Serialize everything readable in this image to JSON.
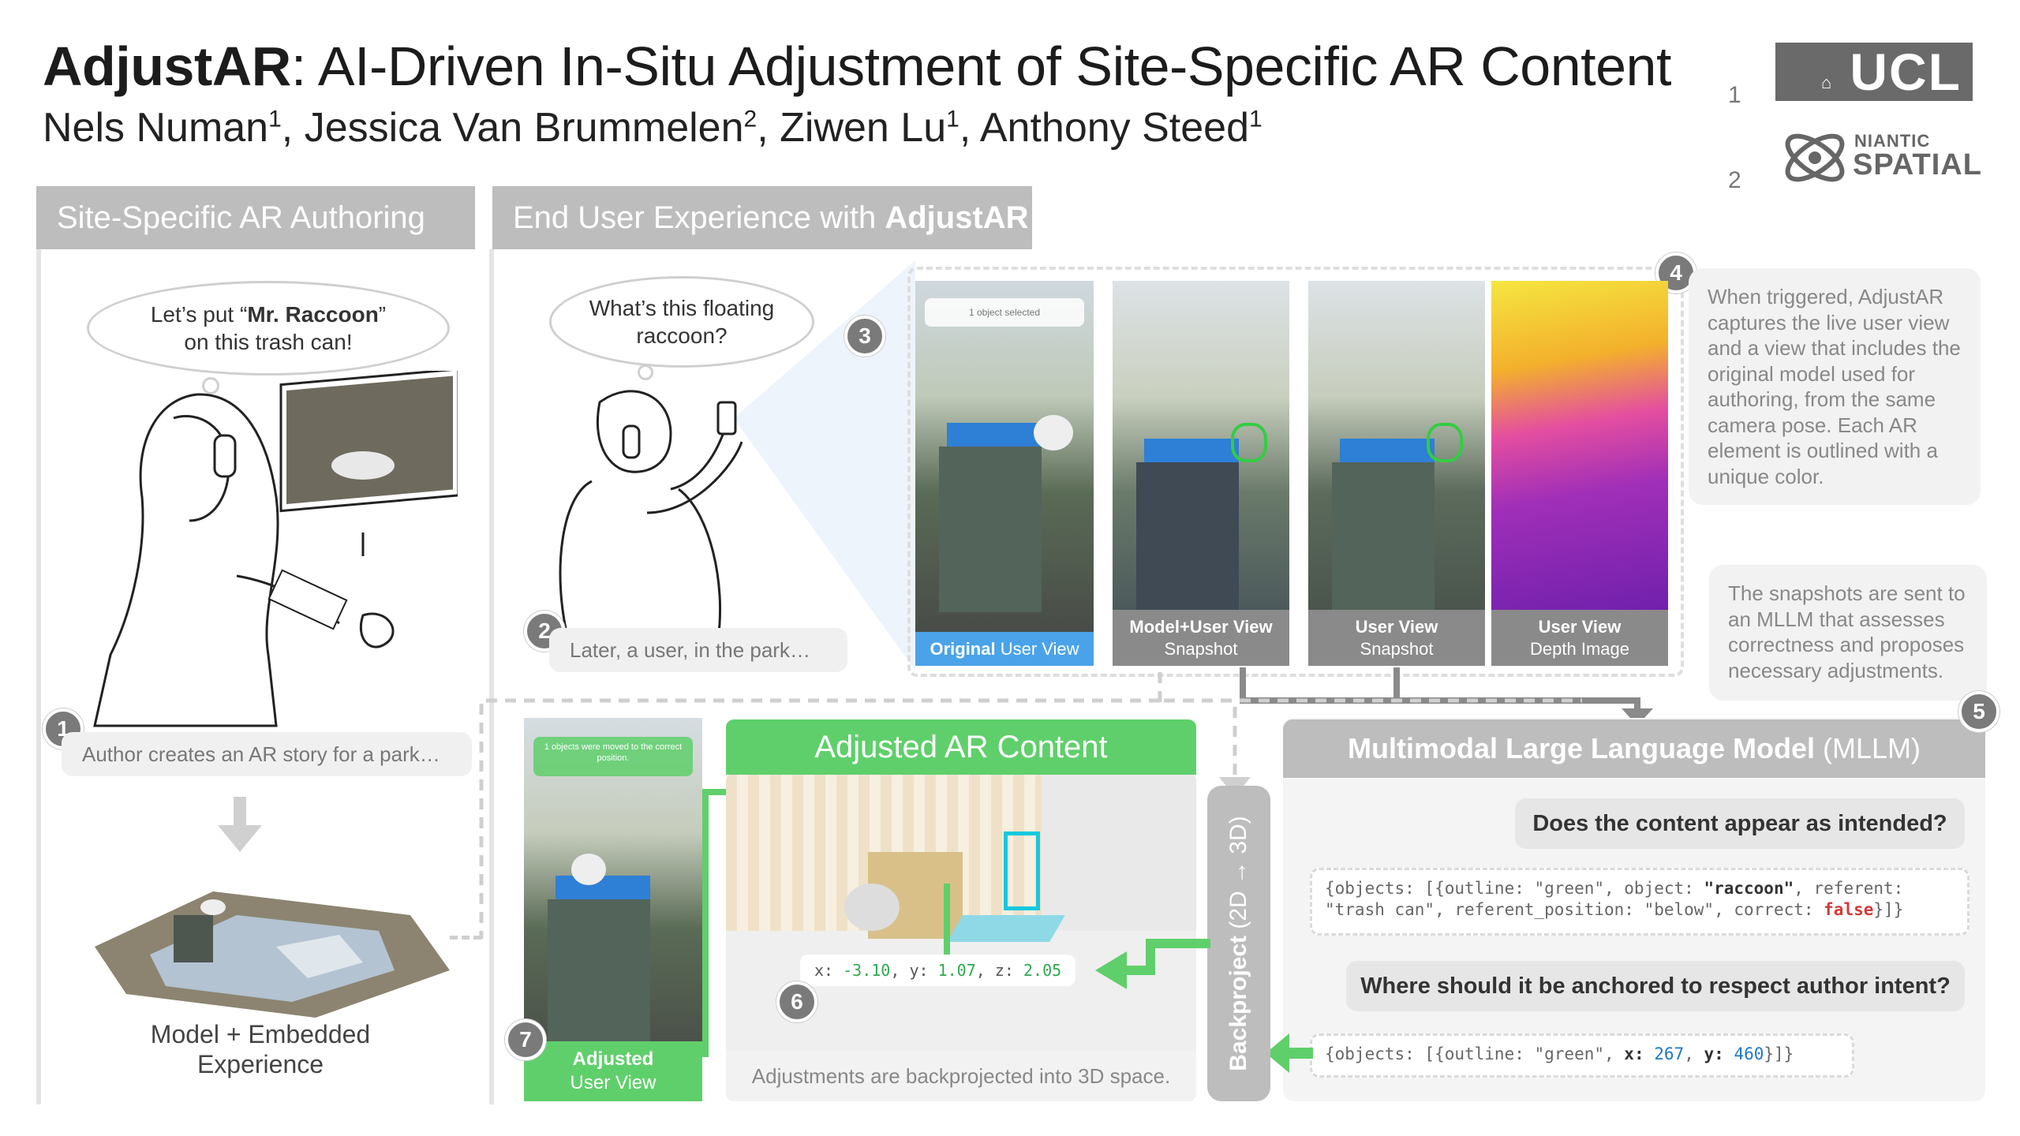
{
  "header": {
    "title_bold": "AdjustAR",
    "title_rest": ": AI-Driven In-Situ Adjustment of Site-Specific AR Content",
    "authors": [
      {
        "name": "Nels Numan",
        "aff": "1"
      },
      {
        "name": "Jessica Van Brummelen",
        "aff": "2"
      },
      {
        "name": "Ziwen Lu",
        "aff": "1"
      },
      {
        "name": "Anthony Steed",
        "aff": "1"
      }
    ],
    "affiliation_1": "1",
    "affiliation_2": "2",
    "logo_ucl": "UCL",
    "logo_niantic_top": "NIANTIC",
    "logo_niantic_bottom": "SPATIAL"
  },
  "authoring": {
    "header": "Site-Specific AR Authoring",
    "bubble_pre": "Let’s put “",
    "bubble_bold": "Mr. Raccoon",
    "bubble_post": "”",
    "bubble_line2": "on this trash can!",
    "step1_badge": "1",
    "step1_caption": "Author creates an AR story for a park…",
    "model_caption_1": "Model + Embedded",
    "model_caption_2": "Experience"
  },
  "enduser": {
    "header_pre": "End User Experience with ",
    "header_bold": "AdjustAR",
    "bubble_line1": "What’s this floating",
    "bubble_line2": "raccoon?",
    "step2_badge": "2",
    "step2_caption": "Later, a user, in the park…",
    "step3_badge": "3",
    "step4_badge": "4",
    "photos": [
      {
        "label_bold": "Original",
        "label_rest": " User View",
        "overlay": "1 object selected"
      },
      {
        "label_bold": "Model+User View",
        "label_line2": "Snapshot"
      },
      {
        "label_bold": "User View",
        "label_line2": "Snapshot"
      },
      {
        "label_bold": "User View",
        "label_line2": "Depth Image"
      }
    ],
    "info_trigger": "When triggered, AdjustAR captures the live user view and a view that includes the original model used for authoring, from the same camera pose. Each AR element is outlined with a unique color.",
    "info_snapshots": "The snapshots are sent to an MLLM that assesses correctness and proposes necessary adjustments."
  },
  "mllm": {
    "step5_badge": "5",
    "header_bold": "Multimodal Large Language Model",
    "header_rest": " (MLLM)",
    "question1": "Does the content appear as intended?",
    "answer1_line1_a": "{objects: [{outline: \"green\", object: ",
    "answer1_line1_b": "\"raccoon\"",
    "answer1_line1_c": ", referent:",
    "answer1_line2_a": "\"trash can\", referent_position: \"below\", correct: ",
    "answer1_line2_b": "false",
    "answer1_line2_c": "}]}",
    "question2": "Where should it be anchored to respect author intent?",
    "answer2_a": "{objects: [{outline: \"green\", ",
    "answer2_x_key": "x:",
    "answer2_x_val": "267",
    "answer2_y_key": "y:",
    "answer2_y_val": "460",
    "answer2_end": "}]}"
  },
  "adjusted": {
    "backproject_bold": "Backproject",
    "backproject_rest": " (2D → 3D)",
    "header": "Adjusted AR Content",
    "coords_x_key": "x:",
    "coords_x": "-3.10",
    "coords_y_key": "y:",
    "coords_y": "1.07",
    "coords_z_key": "z:",
    "coords_z": "2.05",
    "step6_badge": "6",
    "caption": "Adjustments are backprojected into 3D space.",
    "step7_badge": "7",
    "user_view_bold": "Adjusted",
    "user_view_rest": "User View",
    "user_view_overlay": "1 objects were moved to the correct position."
  },
  "colors": {
    "accent_green": "#5fcf6b",
    "header_gray": "#bdbdbd",
    "original_blue": "#4aa3e8",
    "badge_gray": "#7a7a7a",
    "false_red": "#d23a3a"
  }
}
